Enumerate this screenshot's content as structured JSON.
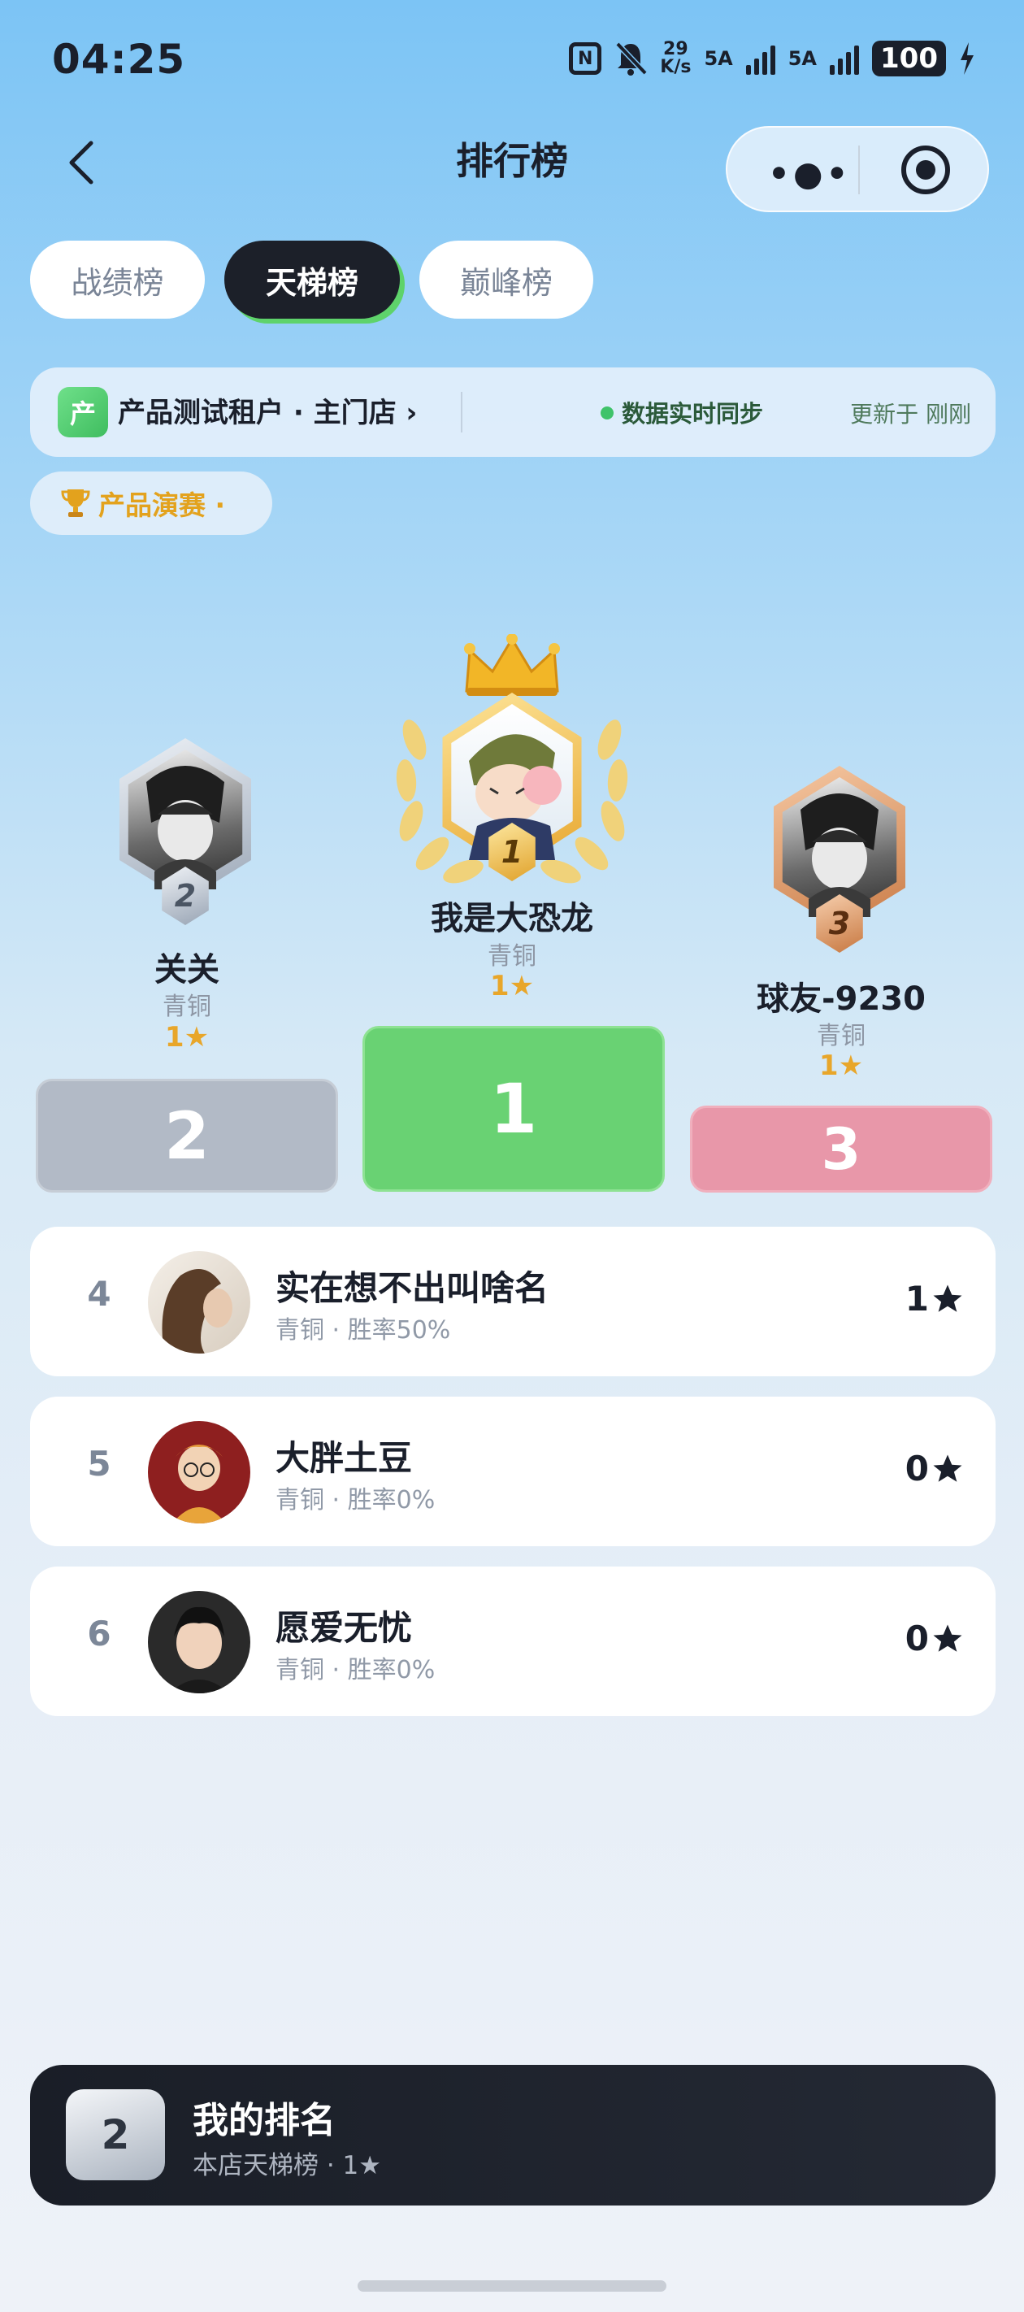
{
  "status": {
    "time": "04:25",
    "net_speed_top": "29",
    "net_speed_bottom": "K/s",
    "sig1": "5A",
    "sig2": "5A",
    "battery": "100"
  },
  "header": {
    "title": "排行榜"
  },
  "tabs": [
    {
      "label": "战绩榜",
      "active": false
    },
    {
      "label": "天梯榜",
      "active": true
    },
    {
      "label": "巅峰榜",
      "active": false
    }
  ],
  "store": {
    "logo_char": "产",
    "name": "产品测试租户 · 主门店 ›",
    "sync": "数据实时同步",
    "updated": "更新于 刚刚"
  },
  "event": {
    "label": "产品演赛 ·"
  },
  "podium": [
    {
      "rank": "1",
      "name": "我是大恐龙",
      "tier": "青铜",
      "stars": "1★"
    },
    {
      "rank": "2",
      "name": "关关",
      "tier": "青铜",
      "stars": "1★"
    },
    {
      "rank": "3",
      "name": "球友-9230",
      "tier": "青铜",
      "stars": "1★"
    }
  ],
  "list": [
    {
      "rank": "4",
      "name": "实在想不出叫啥名",
      "sub": "青铜 · 胜率50%",
      "score": "1"
    },
    {
      "rank": "5",
      "name": "大胖土豆",
      "sub": "青铜 · 胜率0%",
      "score": "0"
    },
    {
      "rank": "6",
      "name": "愿爱无忧",
      "sub": "青铜 · 胜率0%",
      "score": "0"
    }
  ],
  "my_rank": {
    "rank": "2",
    "title": "我的排名",
    "sub": "本店天梯榜 · 1★"
  },
  "colors": {
    "accent_green": "#69d273",
    "silver": "#b2bac6",
    "bronze_pink": "#e897a9",
    "gold": "#e8a62a"
  }
}
